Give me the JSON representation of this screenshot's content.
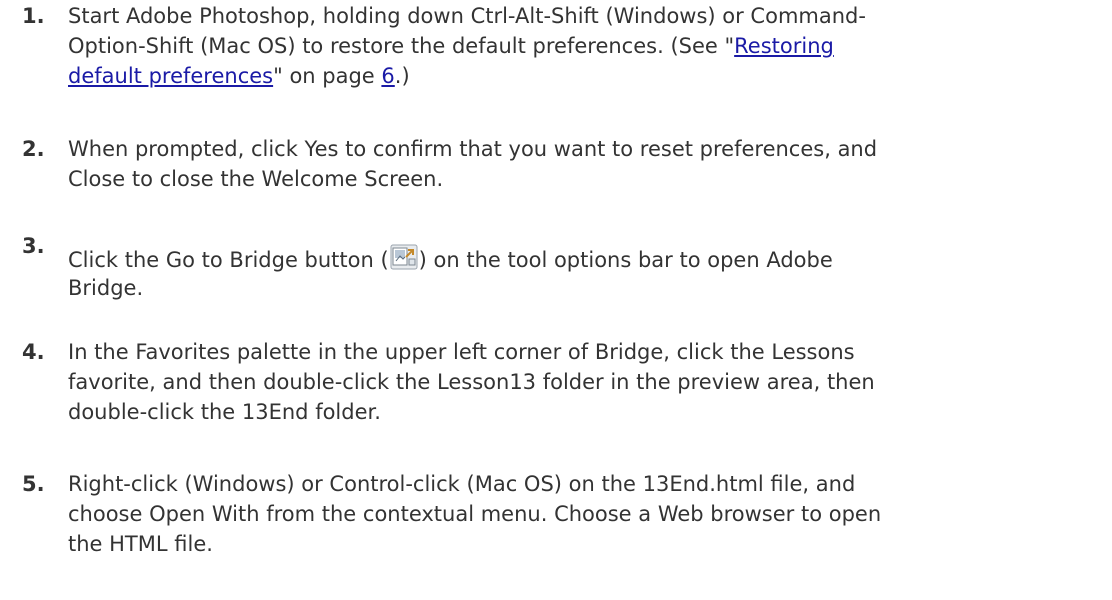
{
  "steps": [
    {
      "number": "1.",
      "line1": "Start Adobe Photoshop, holding down Ctrl-Alt-Shift (Windows) or Command-",
      "line2a": "Option-Shift (Mac OS) to restore the default preferences. (See \"",
      "link1": "Restoring",
      "link2": "default preferences",
      "line3b": "\" on page ",
      "page_link": "6",
      "line3c": ".)"
    },
    {
      "number": "2.",
      "line1": "When prompted, click Yes to confirm that you want to reset preferences, and",
      "line2": "Close to close the Welcome Screen."
    },
    {
      "number": "3.",
      "line1a": "Click the Go to Bridge button (",
      "icon": "go-to-bridge-icon",
      "line1b": ") on the tool options bar to open Adobe",
      "line2": "Bridge."
    },
    {
      "number": "4.",
      "line1": "In the Favorites palette in the upper left corner of Bridge, click the Lessons",
      "line2": "favorite, and then double-click the Lesson13 folder in the preview area, then",
      "line3": "double-click the 13End folder."
    },
    {
      "number": "5.",
      "line1": "Right-click (Windows) or Control-click (Mac OS) on the 13End.html file, and",
      "line2": "choose Open With from the contextual menu. Choose a Web browser to open",
      "line3": "the HTML file."
    }
  ],
  "colors": {
    "text": "#333333",
    "link": "#1a1aa6"
  }
}
